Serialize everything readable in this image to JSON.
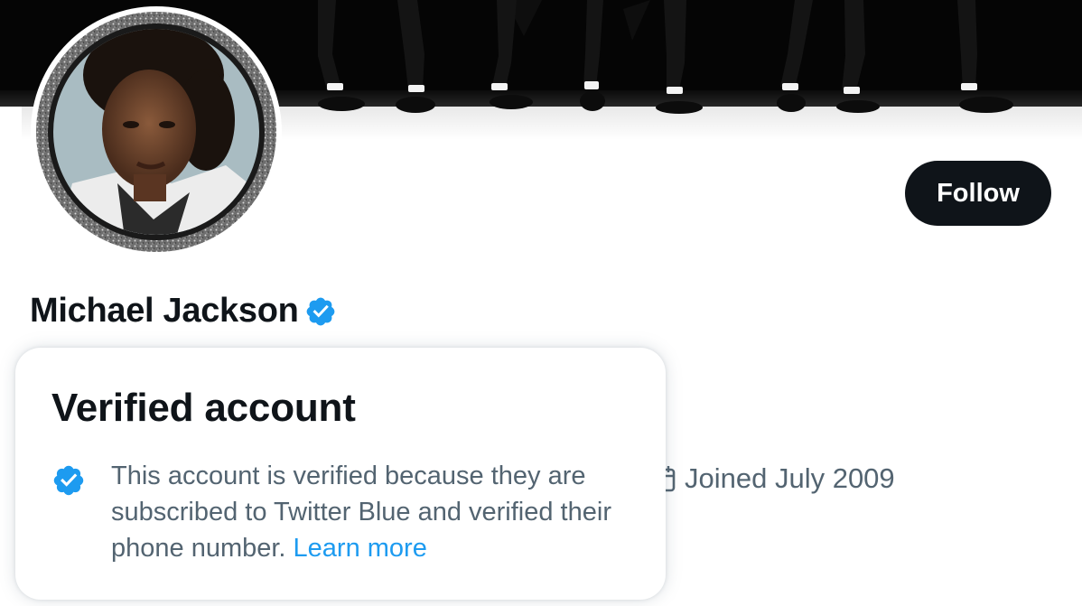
{
  "profile": {
    "display_name": "Michael Jackson",
    "handle_hint": "",
    "joined": "Joined July 2009"
  },
  "actions": {
    "follow_label": "Follow"
  },
  "popover": {
    "title": "Verified account",
    "body": "This account is verified because they are subscribed to Twitter Blue and verified their phone number.",
    "link_label": "Learn more"
  },
  "icons": {
    "verified": "verified-badge-icon",
    "calendar": "calendar-icon"
  },
  "colors": {
    "accent": "#1d9bf0",
    "text_primary": "#0f1419",
    "text_secondary": "#536471",
    "follow_bg": "#0f1419"
  }
}
